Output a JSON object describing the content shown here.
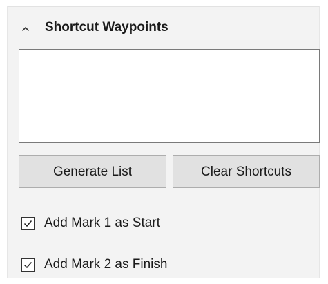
{
  "section": {
    "title": "Shortcut Waypoints",
    "expanded": true,
    "toggle_icon": "chevron-up-icon"
  },
  "waypoint_list": {
    "items": []
  },
  "buttons": {
    "generate_label": "Generate List",
    "clear_label": "Clear Shortcuts"
  },
  "options": {
    "add_mark1_start": {
      "label": "Add Mark 1 as Start",
      "checked": true
    },
    "add_mark2_finish": {
      "label": "Add Mark 2 as Finish",
      "checked": true
    }
  },
  "colors": {
    "panel_bg": "#f3f3f3",
    "button_bg": "#e1e1e1",
    "button_border": "#adadad",
    "list_border": "#7a7a7a"
  }
}
